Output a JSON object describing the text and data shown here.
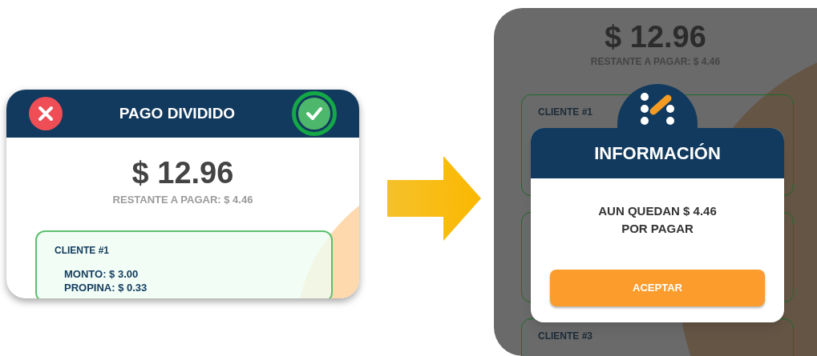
{
  "split_payment": {
    "title": "PAGO DIVIDIDO",
    "confirm_highlighted": true,
    "total": "$ 12.96",
    "remaining": "RESTANTE A PAGAR: $ 4.46",
    "clients": [
      {
        "kind": "client",
        "name": "CLIENTE #1",
        "lines": [
          "MONTO: $ 3.00",
          "PROPINA: $ 0.33"
        ]
      }
    ]
  },
  "dimmed_screen": {
    "total": "$ 12.96",
    "remaining": "RESTANTE A PAGAR: $ 4.46",
    "clients": [
      {
        "kind": "client",
        "name": "CLIENTE #1"
      },
      {
        "kind": "covered"
      },
      {
        "kind": "client",
        "name": "CLIENTE #3"
      }
    ]
  },
  "dialog": {
    "title": "INFORMACIÓN",
    "message": "AUN QUEDAN $ 4.46\nPOR PAGAR",
    "button": "ACEPTAR"
  }
}
